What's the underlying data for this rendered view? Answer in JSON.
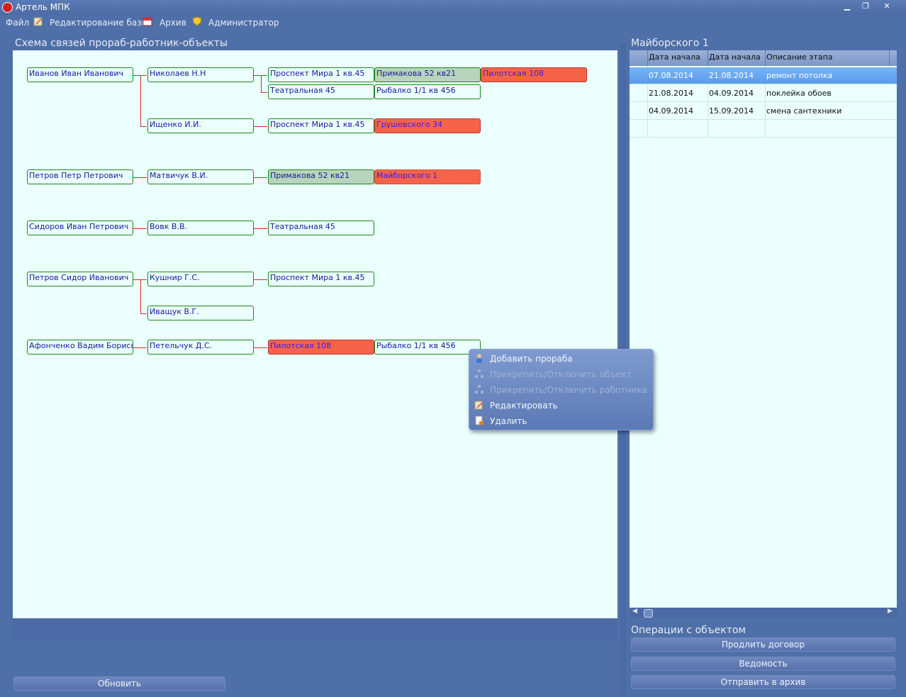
{
  "window": {
    "title": "Артель МПК"
  },
  "menu": {
    "items": [
      "Файл",
      "Редактирование базы",
      "Архив",
      "Администратор"
    ]
  },
  "scheme": {
    "title": "Схема связей прораб-работник-объекты",
    "nodes": [
      {
        "text": "Иванов Иван Иванович",
        "style": "plain"
      },
      {
        "text": "Николаев Н.Н",
        "style": "plain"
      },
      {
        "text": "Проспект Мира 1 кв.45",
        "style": "plain"
      },
      {
        "text": "Примакова 52 кв21",
        "style": "green"
      },
      {
        "text": "Пилотская 108",
        "style": "red"
      },
      {
        "text": "Театральная 45",
        "style": "plain"
      },
      {
        "text": "Рыбалко 1/1 кв 456",
        "style": "plain"
      },
      {
        "text": "Ищенко И.И.",
        "style": "plain"
      },
      {
        "text": "Проспект Мира 1 кв.45",
        "style": "plain"
      },
      {
        "text": "Грушевского 34",
        "style": "red"
      },
      {
        "text": "Петров Петр Петрович",
        "style": "plain"
      },
      {
        "text": "Матвичук В.И.",
        "style": "plain"
      },
      {
        "text": "Примакова 52 кв21",
        "style": "green"
      },
      {
        "text": "Майборского 1",
        "style": "red"
      },
      {
        "text": "Сидоров Иван Петрович",
        "style": "plain"
      },
      {
        "text": "Вовк В.В.",
        "style": "plain"
      },
      {
        "text": "Театральная 45",
        "style": "plain"
      },
      {
        "text": "Петров Сидор Иванович",
        "style": "plain"
      },
      {
        "text": "Кушнир Г.С.",
        "style": "plain"
      },
      {
        "text": "Проспект Мира 1 кв.45",
        "style": "plain"
      },
      {
        "text": "Иващук В.Г.",
        "style": "plain"
      },
      {
        "text": "Афонченко Вадим Борисович",
        "style": "plain"
      },
      {
        "text": "Петельчук Д.С.",
        "style": "plain"
      },
      {
        "text": "Пилотская 108",
        "style": "red"
      },
      {
        "text": "Рыбалко 1/1 кв 456",
        "style": "plain"
      }
    ]
  },
  "refresh_button": "Обновить",
  "context_menu": {
    "items": [
      {
        "label": "Добавить прораба",
        "enabled": true
      },
      {
        "label": "Прикрепить/Отключить объект",
        "enabled": false
      },
      {
        "label": "Прикрепить/Отключить работника",
        "enabled": false
      },
      {
        "label": "Редактировать",
        "enabled": true
      },
      {
        "label": "Удалить",
        "enabled": true
      }
    ]
  },
  "object_panel": {
    "title": "Майборского 1",
    "columns": [
      "Дата начала",
      "Дата начала",
      "Описание этапа"
    ],
    "rows": [
      [
        "07.08.2014",
        "21.08.2014",
        "ремонт потолка"
      ],
      [
        "21.08.2014",
        "04.09.2014",
        "поклейка обоев"
      ],
      [
        "04.09.2014",
        "15.09.2014",
        "смена сантехники"
      ]
    ]
  },
  "operations": {
    "title": "Операции с объектом",
    "buttons": [
      "Продлить договор",
      "Ведомость",
      "Отправить в архив"
    ]
  }
}
